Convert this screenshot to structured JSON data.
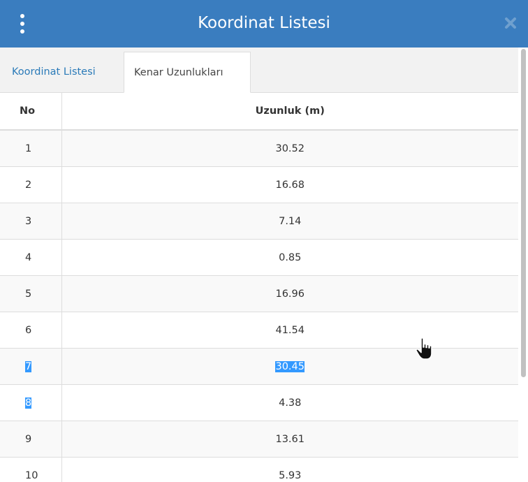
{
  "window": {
    "title": "Koordinat Listesi",
    "menu_icon": "vertical-ellipsis-icon",
    "close_icon": "close-x-icon"
  },
  "tabs": [
    {
      "label": "Koordinat Listesi",
      "active": false
    },
    {
      "label": "Kenar Uzunlukları",
      "active": true
    }
  ],
  "table": {
    "columns": [
      "No",
      "Uzunluk (m)"
    ],
    "rows": [
      {
        "no": "1",
        "length": "30.52",
        "selected_no": false,
        "selected_length": false
      },
      {
        "no": "2",
        "length": "16.68",
        "selected_no": false,
        "selected_length": false
      },
      {
        "no": "3",
        "length": "7.14",
        "selected_no": false,
        "selected_length": false
      },
      {
        "no": "4",
        "length": "0.85",
        "selected_no": false,
        "selected_length": false
      },
      {
        "no": "5",
        "length": "16.96",
        "selected_no": false,
        "selected_length": false
      },
      {
        "no": "6",
        "length": "41.54",
        "selected_no": false,
        "selected_length": false
      },
      {
        "no": "7",
        "length": "30.45",
        "selected_no": true,
        "selected_length": true
      },
      {
        "no": "8",
        "length": "4.38",
        "selected_no": true,
        "selected_length": false
      },
      {
        "no": "9",
        "length": "13.61",
        "selected_no": false,
        "selected_length": false
      },
      {
        "no": "10",
        "length": "5.93",
        "selected_no": false,
        "selected_length": false
      }
    ]
  },
  "colors": {
    "titlebar": "#3a7dbf",
    "tab_link": "#2a7ab8",
    "selection": "#3399ff"
  },
  "cursor_icon": "hand-pointer-icon"
}
